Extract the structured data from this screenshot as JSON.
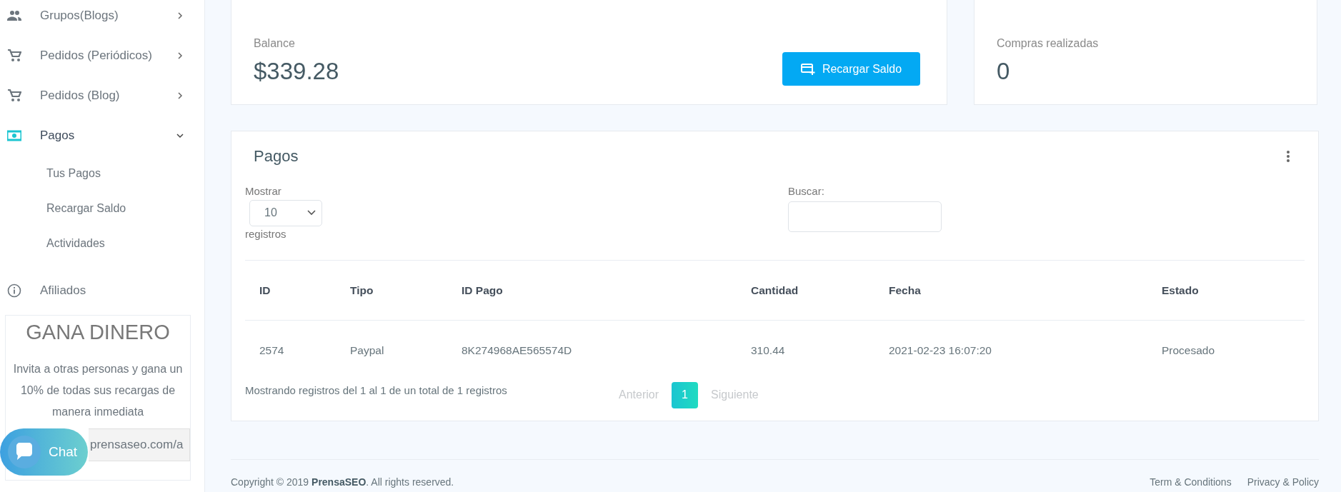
{
  "sidebar": {
    "items": [
      {
        "label": "Grupos(Blogs)",
        "expanded": false,
        "selected": false
      },
      {
        "label": "Pedidos (Periódicos)",
        "expanded": false,
        "selected": false
      },
      {
        "label": "Pedidos (Blog)",
        "expanded": false,
        "selected": false
      },
      {
        "label": "Pagos",
        "expanded": true,
        "selected": true,
        "children": [
          {
            "label": "Tus Pagos"
          },
          {
            "label": "Recargar Saldo"
          },
          {
            "label": "Actividades"
          }
        ]
      },
      {
        "label": "Afiliados",
        "selected": false
      }
    ],
    "promo": {
      "title": "GANA DINERO",
      "text": "Invita a otras personas y gana un 10% de todas sus recargas de manera inmediata",
      "link_value": "prensaseo.com/a"
    }
  },
  "chat": {
    "label": "Chat"
  },
  "balance_card": {
    "label": "Balance",
    "value": "$339.28",
    "button": "Recargar Saldo"
  },
  "purchases_card": {
    "label": "Compras realizadas",
    "value": "0"
  },
  "payments": {
    "title": "Pagos",
    "length_label_before": "Mostrar",
    "length_value": "10",
    "length_label_after": "registros",
    "search_label": "Buscar:",
    "table": {
      "columns": [
        "ID",
        "Tipo",
        "ID Pago",
        "Cantidad",
        "Fecha",
        "Estado"
      ],
      "rows": [
        [
          "2574",
          "Paypal",
          "8K274968AE565574D",
          "310.44",
          "2021-02-23 16:07:20",
          "Procesado"
        ]
      ]
    },
    "info": "Mostrando registros del 1 al 1 de un total de 1 registros",
    "pagination": [
      {
        "label": "Anterior",
        "disabled": true,
        "selected": false
      },
      {
        "label": "1",
        "disabled": false,
        "selected": true
      },
      {
        "label": "Siguiente",
        "disabled": true,
        "selected": false
      }
    ]
  },
  "footer": {
    "copyright": "Copyright © 2019 **PrensaSEO**. All rights reserved.",
    "links": [
      "Term & Conditions",
      "Privacy & Policy"
    ]
  }
}
